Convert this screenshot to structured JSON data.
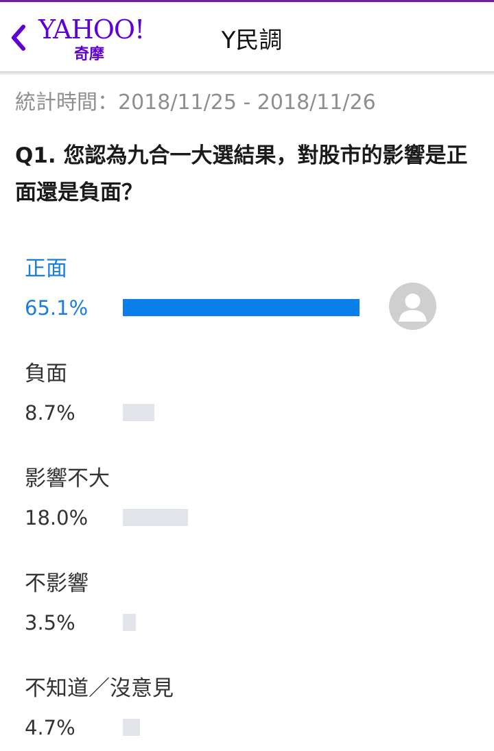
{
  "header": {
    "logo_main": "YAHOO!",
    "logo_sub": "奇摩",
    "title": "Y民調",
    "back_icon": "chevron-left-icon",
    "accent_color": "#5f01d1"
  },
  "poll": {
    "stats_period": "統計時間：2018/11/25 - 2018/11/26",
    "question": "Q1. 您認為九合一大選結果，對股市的影響是正面還是負面？",
    "selected_color": "#0a7ee9",
    "options": [
      {
        "label": "正面",
        "percent_text": "65.1%",
        "value": 65.1,
        "selected": true
      },
      {
        "label": "負面",
        "percent_text": "8.7%",
        "value": 8.7,
        "selected": false
      },
      {
        "label": "影響不大",
        "percent_text": "18.0%",
        "value": 18.0,
        "selected": false
      },
      {
        "label": "不影響",
        "percent_text": "3.5%",
        "value": 3.5,
        "selected": false
      },
      {
        "label": "不知道／沒意見",
        "percent_text": "4.7%",
        "value": 4.7,
        "selected": false
      }
    ],
    "voter_avatar_icon": "user-avatar-icon"
  }
}
